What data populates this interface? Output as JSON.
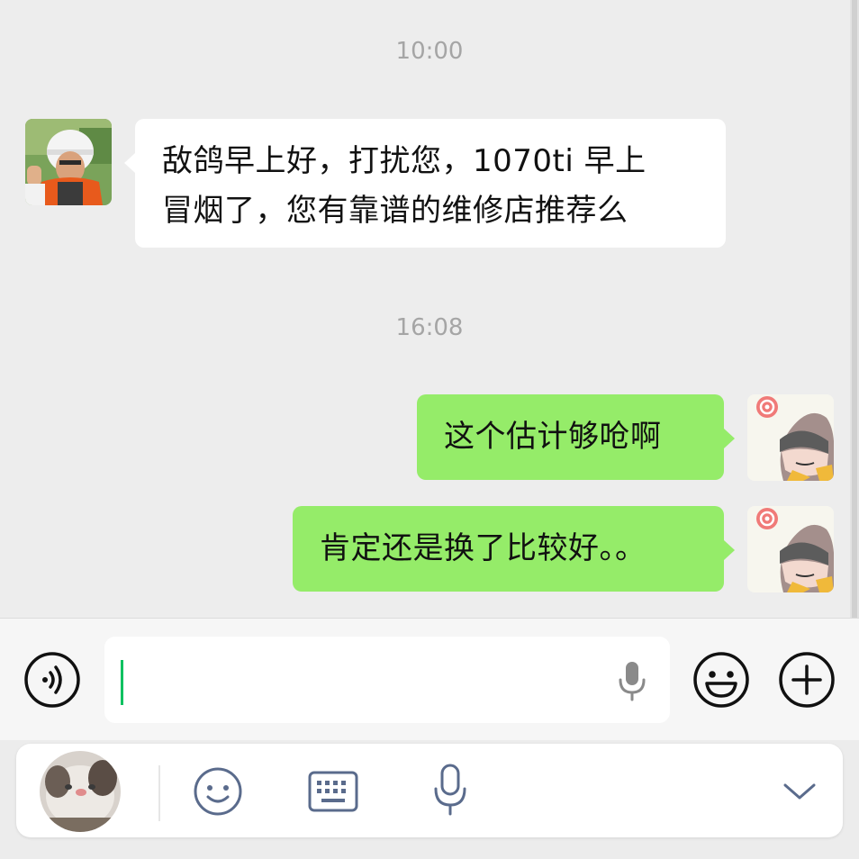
{
  "messages": [
    {
      "type": "timestamp",
      "text": "10:00"
    },
    {
      "type": "incoming",
      "line1": "敌鸽早上好，打扰您，1070ti 早上",
      "line2": "冒烟了，您有靠谱的维修店推荐么"
    },
    {
      "type": "timestamp",
      "text": "16:08"
    },
    {
      "type": "outgoing",
      "text": "这个估计够呛啊"
    },
    {
      "type": "outgoing",
      "text": "肯定还是换了比较好。。"
    }
  ],
  "input_bar": {
    "voice_button": "voice-toggle-icon",
    "input_value": "",
    "mic_icon": "microphone-icon",
    "emoji_button": "emoji-icon",
    "more_button": "plus-icon"
  },
  "ime_toolbar": {
    "icons": [
      "ime-avatar",
      "emoji-face-icon",
      "keyboard-icon",
      "microphone-icon",
      "chevron-down-icon"
    ]
  },
  "colors": {
    "background": "#ededed",
    "incoming_bubble": "#ffffff",
    "outgoing_bubble": "#95ec69",
    "cursor": "#07c160",
    "ime_icon": "#5a6b8c"
  }
}
